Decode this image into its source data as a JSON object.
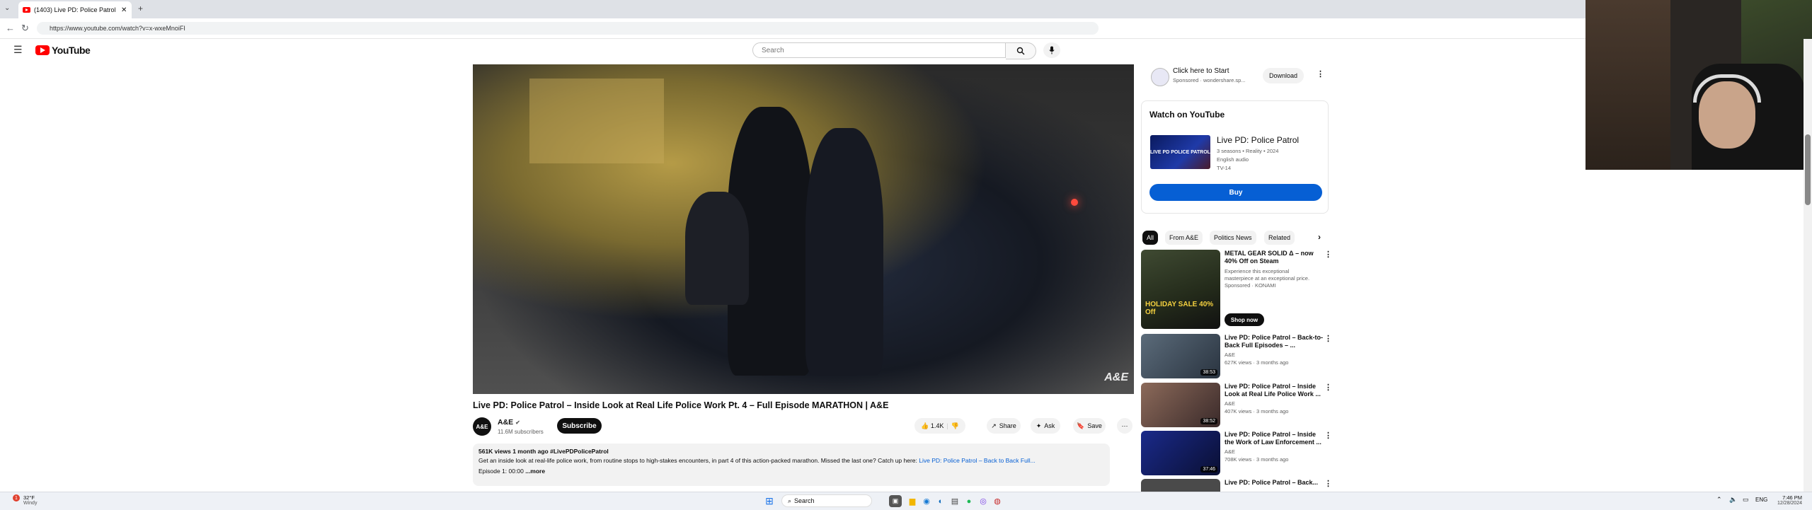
{
  "browser": {
    "tab_title": "(1403) Live PD: Police Patrol -",
    "url": "https://www.youtube.com/watch?v=x-wxeMnoiFI"
  },
  "masthead": {
    "logo_text": "YouTube",
    "search_placeholder": "Search"
  },
  "video": {
    "title": "Live PD: Police Patrol – Inside Look at Real Life Police Work Pt. 4 – Full Episode MARATHON | A&E",
    "watermark": "A&E",
    "channel_name": "A&E",
    "subscribers": "11.6M subscribers",
    "subscribe_label": "Subscribe",
    "likes": "1.4K",
    "share_label": "Share",
    "ask_label": "Ask",
    "save_label": "Save",
    "views_line": "561K views  1 month ago  #LivePDPolicePatrol",
    "description": "Get an inside look at real-life police work, from routine stops to high-stakes encounters, in part 4 of this action-packed marathon. Missed the last one? Catch up here:",
    "description_link": "Live PD: Police Patrol – Back to Back Full...",
    "episode_line": "Episode 1: 00:00",
    "more_label": "...more"
  },
  "sidebar": {
    "ad": {
      "title": "Click here to Start",
      "sponsored": "Sponsored · wondershare.sp...",
      "download_label": "Download"
    },
    "watch_card": {
      "heading": "Watch on YouTube",
      "show_title": "Live PD: Police Patrol",
      "meta1": "3 seasons • Reality • 2024",
      "meta2": "English audio",
      "rating": "TV-14",
      "buy_label": "Buy",
      "thumb_text": "LIVE PD POLICE PATROL"
    },
    "chips": [
      "All",
      "From A&E",
      "Politics News",
      "Related"
    ],
    "recommendations": [
      {
        "title": "METAL GEAR SOLID Δ – now 40% Off on Steam",
        "line1": "Experience this exceptional",
        "line2": "masterpiece at an exceptional price.",
        "line3": "Sponsored · KONAMI",
        "cta": "Shop now",
        "thumb_text": "HOLIDAY SALE 40% Off"
      },
      {
        "title": "Live PD: Police Patrol – Back-to-Back Full Episodes – ...",
        "channel": "A&E",
        "stats": "627K views · 3 months ago",
        "duration": "38:53"
      },
      {
        "title": "Live PD: Police Patrol – Inside Look at Real Life Police Work ...",
        "channel": "A&E",
        "stats": "407K views · 3 months ago",
        "duration": "38:52"
      },
      {
        "title": "Live PD: Police Patrol – Inside the Work of Law Enforcement ...",
        "channel": "A&E",
        "stats": "708K views · 3 months ago",
        "duration": "37:46"
      },
      {
        "title": "Live PD: Police Patrol – Back...",
        "channel": "",
        "stats": "",
        "duration": ""
      }
    ]
  },
  "taskbar": {
    "weather_temp": "32°F",
    "weather_desc": "Windy",
    "search_label": "Search",
    "time": "7:46 PM",
    "date": "12/28/2024",
    "lang": "ENG"
  },
  "colors": {
    "youtube_red": "#ff0000",
    "buy_blue": "#065fd4",
    "subscribe_black": "#0f0f0f"
  }
}
